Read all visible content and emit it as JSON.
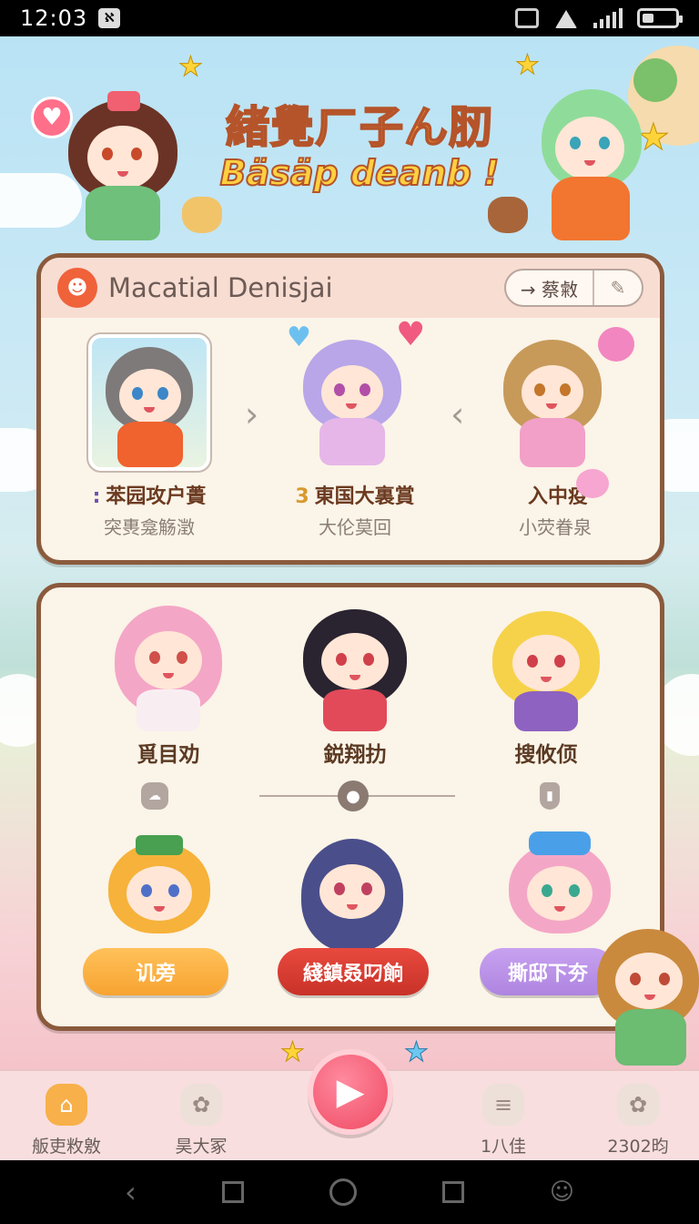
{
  "status_bar": {
    "time": "12:03",
    "nfc": "ℵ"
  },
  "banner": {
    "title_line1": "緒覺ㄏ子ん肕",
    "title_line2": "Bäsäp deanb !"
  },
  "panel_top": {
    "title": "Macatial Denisjai",
    "action_label": "→ 蔡敹",
    "cards": [
      {
        "name": "苯园攻户蕢",
        "prefix": ":",
        "sub": "突軣龛觞澂"
      },
      {
        "name": "東国大裏賞",
        "prefix": "3",
        "sub": "大伦莫回"
      },
      {
        "name": "入中疫",
        "prefix": "",
        "sub": "小荧眷泉"
      }
    ]
  },
  "panel_bottom": {
    "row1_labels": [
      "覓目劝",
      "鋭翔扐",
      "搜攸㑔"
    ],
    "buttons": [
      {
        "label": "讥旁",
        "color": "#f7a330"
      },
      {
        "label": "綫鎮叒叼餉",
        "color": "#c83228"
      },
      {
        "label": "撕邸下夯",
        "color": "#ae84e0"
      }
    ]
  },
  "nav": {
    "items": [
      {
        "label": "舨吏敉敫",
        "icon": "home-icon"
      },
      {
        "label": "昊大冢",
        "icon": "flower-icon"
      },
      {
        "label": "1八佳",
        "icon": "stack-icon"
      },
      {
        "label": "2302昀",
        "icon": "flower-icon"
      }
    ],
    "play_icon": "play-icon"
  }
}
